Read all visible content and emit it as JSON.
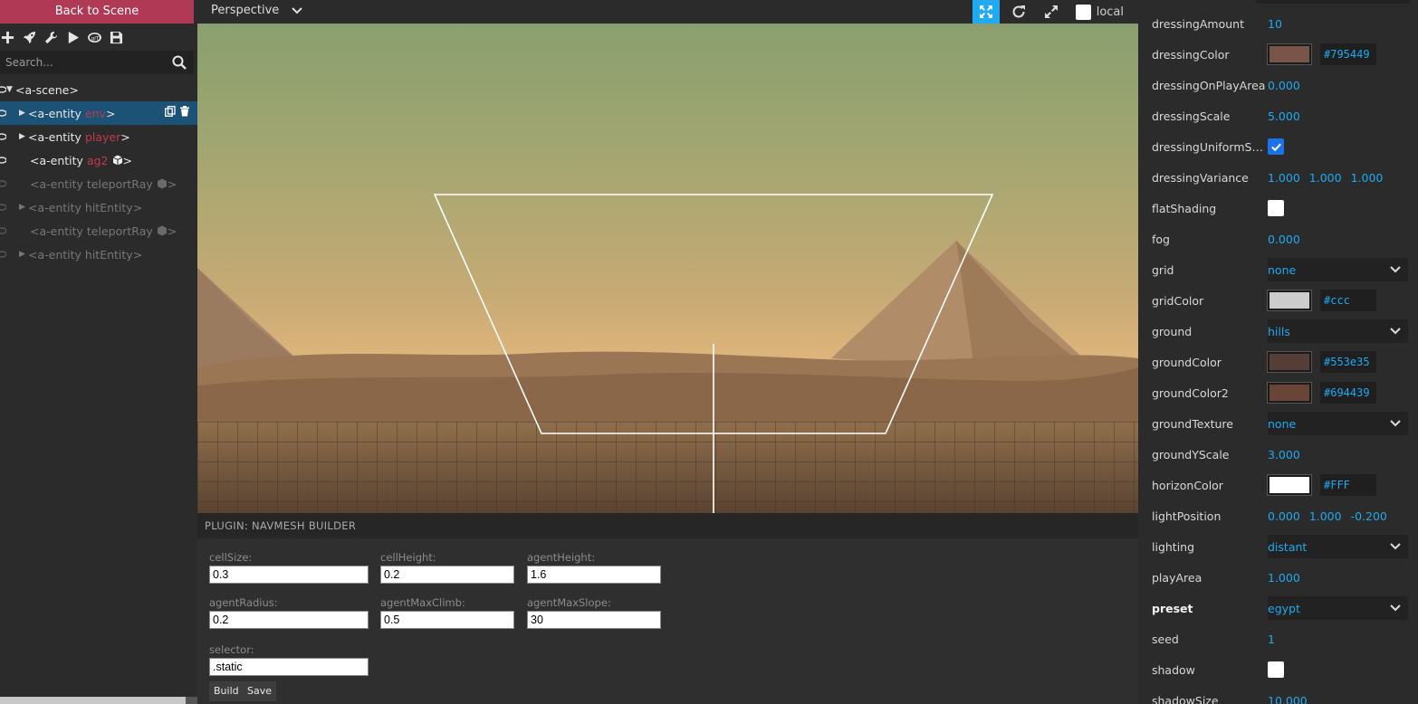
{
  "left_panel": {
    "back_label": "Back to Scene",
    "search_placeholder": "Search...",
    "tree": [
      {
        "tag": "<a-scene>",
        "ident": "",
        "close": ""
      },
      {
        "tag": "<a-entity",
        "ident": "env",
        "close": ">"
      },
      {
        "tag": "<a-entity",
        "ident": "player",
        "close": ">"
      },
      {
        "tag": "<a-entity",
        "ident": "ag2",
        "close": ">"
      },
      {
        "tag": "<a-entity teleportRay",
        "ident": "",
        "close": ">"
      },
      {
        "tag": "<a-entity hitEntity",
        "ident": "",
        "close": ">"
      },
      {
        "tag": "<a-entity teleportRay",
        "ident": "",
        "close": ">"
      },
      {
        "tag": "<a-entity hitEntity",
        "ident": "",
        "close": ">"
      }
    ]
  },
  "topbar": {
    "camera": "Perspective",
    "local_label": "local"
  },
  "plugin": {
    "title": "PLUGIN: NAVMESH BUILDER",
    "fields": {
      "cellSize": {
        "label": "cellSize:",
        "value": "0.3"
      },
      "cellHeight": {
        "label": "cellHeight:",
        "value": "0.2"
      },
      "agentHeight": {
        "label": "agentHeight:",
        "value": "1.6"
      },
      "agentRadius": {
        "label": "agentRadius:",
        "value": "0.2"
      },
      "agentMaxClimb": {
        "label": "agentMaxClimb:",
        "value": "0.5"
      },
      "agentMaxSlope": {
        "label": "agentMaxSlope:",
        "value": "30"
      },
      "selector": {
        "label": "selector:",
        "value": ".static"
      }
    },
    "build_label": "Build",
    "save_label": "Save"
  },
  "properties": {
    "dressingAmount": {
      "name": "dressingAmount",
      "value": "10"
    },
    "dressingColor": {
      "name": "dressingColor",
      "value": "#795449",
      "swatch": "#795449"
    },
    "dressingOnPlayArea": {
      "name": "dressingOnPlayArea",
      "value": "0.000"
    },
    "dressingScale": {
      "name": "dressingScale",
      "value": "5.000"
    },
    "dressingUniformScale": {
      "name": "dressingUniformSc...",
      "checked": true
    },
    "dressingVariance": {
      "name": "dressingVariance",
      "x": "1.000",
      "y": "1.000",
      "z": "1.000"
    },
    "flatShading": {
      "name": "flatShading",
      "checked": false
    },
    "fog": {
      "name": "fog",
      "value": "0.000"
    },
    "grid": {
      "name": "grid",
      "value": "none"
    },
    "gridColor": {
      "name": "gridColor",
      "value": "#ccc",
      "swatch": "#cccccc"
    },
    "ground": {
      "name": "ground",
      "value": "hills"
    },
    "groundColor": {
      "name": "groundColor",
      "value": "#553e35",
      "swatch": "#553e35"
    },
    "groundColor2": {
      "name": "groundColor2",
      "value": "#694439",
      "swatch": "#694439"
    },
    "groundTexture": {
      "name": "groundTexture",
      "value": "none"
    },
    "groundYScale": {
      "name": "groundYScale",
      "value": "3.000"
    },
    "horizonColor": {
      "name": "horizonColor",
      "value": "#FFF",
      "swatch": "#ffffff"
    },
    "lightPosition": {
      "name": "lightPosition",
      "x": "0.000",
      "y": "1.000",
      "z": "-0.200"
    },
    "lighting": {
      "name": "lighting",
      "value": "distant"
    },
    "playArea": {
      "name": "playArea",
      "value": "1.000"
    },
    "preset": {
      "name": "preset",
      "value": "egypt"
    },
    "seed": {
      "name": "seed",
      "value": "1"
    },
    "shadow": {
      "name": "shadow",
      "checked": false
    },
    "shadowSize": {
      "name": "shadowSize",
      "value": "10.000"
    }
  },
  "colors": {
    "accent": "#1faaf2",
    "back_button": "#b03a56",
    "selected_row": "#1b5276"
  }
}
